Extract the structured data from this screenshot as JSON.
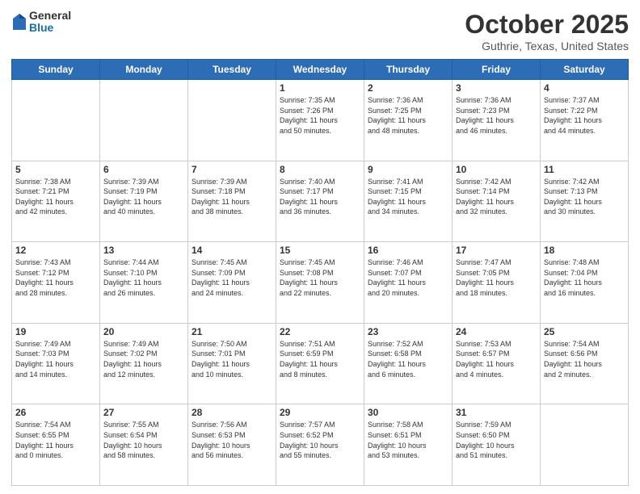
{
  "logo": {
    "general": "General",
    "blue": "Blue"
  },
  "header": {
    "month": "October 2025",
    "location": "Guthrie, Texas, United States"
  },
  "days_of_week": [
    "Sunday",
    "Monday",
    "Tuesday",
    "Wednesday",
    "Thursday",
    "Friday",
    "Saturday"
  ],
  "weeks": [
    [
      {
        "day": "",
        "info": ""
      },
      {
        "day": "",
        "info": ""
      },
      {
        "day": "",
        "info": ""
      },
      {
        "day": "1",
        "info": "Sunrise: 7:35 AM\nSunset: 7:26 PM\nDaylight: 11 hours\nand 50 minutes."
      },
      {
        "day": "2",
        "info": "Sunrise: 7:36 AM\nSunset: 7:25 PM\nDaylight: 11 hours\nand 48 minutes."
      },
      {
        "day": "3",
        "info": "Sunrise: 7:36 AM\nSunset: 7:23 PM\nDaylight: 11 hours\nand 46 minutes."
      },
      {
        "day": "4",
        "info": "Sunrise: 7:37 AM\nSunset: 7:22 PM\nDaylight: 11 hours\nand 44 minutes."
      }
    ],
    [
      {
        "day": "5",
        "info": "Sunrise: 7:38 AM\nSunset: 7:21 PM\nDaylight: 11 hours\nand 42 minutes."
      },
      {
        "day": "6",
        "info": "Sunrise: 7:39 AM\nSunset: 7:19 PM\nDaylight: 11 hours\nand 40 minutes."
      },
      {
        "day": "7",
        "info": "Sunrise: 7:39 AM\nSunset: 7:18 PM\nDaylight: 11 hours\nand 38 minutes."
      },
      {
        "day": "8",
        "info": "Sunrise: 7:40 AM\nSunset: 7:17 PM\nDaylight: 11 hours\nand 36 minutes."
      },
      {
        "day": "9",
        "info": "Sunrise: 7:41 AM\nSunset: 7:15 PM\nDaylight: 11 hours\nand 34 minutes."
      },
      {
        "day": "10",
        "info": "Sunrise: 7:42 AM\nSunset: 7:14 PM\nDaylight: 11 hours\nand 32 minutes."
      },
      {
        "day": "11",
        "info": "Sunrise: 7:42 AM\nSunset: 7:13 PM\nDaylight: 11 hours\nand 30 minutes."
      }
    ],
    [
      {
        "day": "12",
        "info": "Sunrise: 7:43 AM\nSunset: 7:12 PM\nDaylight: 11 hours\nand 28 minutes."
      },
      {
        "day": "13",
        "info": "Sunrise: 7:44 AM\nSunset: 7:10 PM\nDaylight: 11 hours\nand 26 minutes."
      },
      {
        "day": "14",
        "info": "Sunrise: 7:45 AM\nSunset: 7:09 PM\nDaylight: 11 hours\nand 24 minutes."
      },
      {
        "day": "15",
        "info": "Sunrise: 7:45 AM\nSunset: 7:08 PM\nDaylight: 11 hours\nand 22 minutes."
      },
      {
        "day": "16",
        "info": "Sunrise: 7:46 AM\nSunset: 7:07 PM\nDaylight: 11 hours\nand 20 minutes."
      },
      {
        "day": "17",
        "info": "Sunrise: 7:47 AM\nSunset: 7:05 PM\nDaylight: 11 hours\nand 18 minutes."
      },
      {
        "day": "18",
        "info": "Sunrise: 7:48 AM\nSunset: 7:04 PM\nDaylight: 11 hours\nand 16 minutes."
      }
    ],
    [
      {
        "day": "19",
        "info": "Sunrise: 7:49 AM\nSunset: 7:03 PM\nDaylight: 11 hours\nand 14 minutes."
      },
      {
        "day": "20",
        "info": "Sunrise: 7:49 AM\nSunset: 7:02 PM\nDaylight: 11 hours\nand 12 minutes."
      },
      {
        "day": "21",
        "info": "Sunrise: 7:50 AM\nSunset: 7:01 PM\nDaylight: 11 hours\nand 10 minutes."
      },
      {
        "day": "22",
        "info": "Sunrise: 7:51 AM\nSunset: 6:59 PM\nDaylight: 11 hours\nand 8 minutes."
      },
      {
        "day": "23",
        "info": "Sunrise: 7:52 AM\nSunset: 6:58 PM\nDaylight: 11 hours\nand 6 minutes."
      },
      {
        "day": "24",
        "info": "Sunrise: 7:53 AM\nSunset: 6:57 PM\nDaylight: 11 hours\nand 4 minutes."
      },
      {
        "day": "25",
        "info": "Sunrise: 7:54 AM\nSunset: 6:56 PM\nDaylight: 11 hours\nand 2 minutes."
      }
    ],
    [
      {
        "day": "26",
        "info": "Sunrise: 7:54 AM\nSunset: 6:55 PM\nDaylight: 11 hours\nand 0 minutes."
      },
      {
        "day": "27",
        "info": "Sunrise: 7:55 AM\nSunset: 6:54 PM\nDaylight: 10 hours\nand 58 minutes."
      },
      {
        "day": "28",
        "info": "Sunrise: 7:56 AM\nSunset: 6:53 PM\nDaylight: 10 hours\nand 56 minutes."
      },
      {
        "day": "29",
        "info": "Sunrise: 7:57 AM\nSunset: 6:52 PM\nDaylight: 10 hours\nand 55 minutes."
      },
      {
        "day": "30",
        "info": "Sunrise: 7:58 AM\nSunset: 6:51 PM\nDaylight: 10 hours\nand 53 minutes."
      },
      {
        "day": "31",
        "info": "Sunrise: 7:59 AM\nSunset: 6:50 PM\nDaylight: 10 hours\nand 51 minutes."
      },
      {
        "day": "",
        "info": ""
      }
    ]
  ]
}
